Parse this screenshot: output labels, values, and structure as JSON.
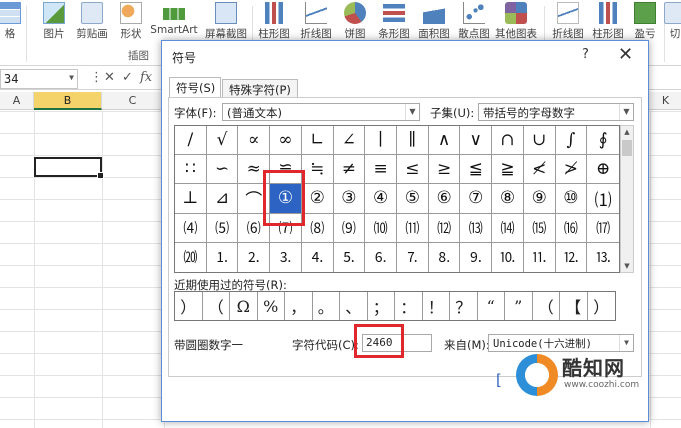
{
  "ribbon": {
    "buttons": [
      "格",
      "图片",
      "剪贴画",
      "形状",
      "SmartArt",
      "屏幕截图",
      "柱形图",
      "折线图",
      "饼图",
      "条形图",
      "面积图",
      "散点图",
      "其他图表",
      "折线图",
      "柱形图",
      "盈亏"
    ],
    "right_cut": "切",
    "group_label": "插图"
  },
  "formula_bar": {
    "name_box": "34",
    "cancel": "✕",
    "enter": "✓",
    "fx": "fx"
  },
  "columns": [
    "A",
    "B",
    "C",
    "K"
  ],
  "dialog": {
    "title": "符号",
    "help": "?",
    "close": "✕",
    "tabs": [
      "符号(S)",
      "特殊字符(P)"
    ],
    "font_label": "字体(F):",
    "font_value": "(普通文本)",
    "subset_label": "子集(U):",
    "subset_value": "带括号的字母数字",
    "symbols": [
      [
        "/",
        "√",
        "∝",
        "∞",
        "∟",
        "∠",
        "∣",
        "∥",
        "∧",
        "∨",
        "∩",
        "∪",
        "∫",
        "∮",
        "∴"
      ],
      [
        "∷",
        "∽",
        "≈",
        "≌",
        "≒",
        "≠",
        "≡",
        "≤",
        "≥",
        "≦",
        "≧",
        "≮",
        "≯",
        "⊕",
        "⊙"
      ],
      [
        "⊥",
        "⊿",
        "⌒",
        "①",
        "②",
        "③",
        "④",
        "⑤",
        "⑥",
        "⑦",
        "⑧",
        "⑨",
        "⑩",
        "⑴",
        "⑵"
      ],
      [
        "⑷",
        "⑸",
        "⑹",
        "⑺",
        "⑻",
        "⑼",
        "⑽",
        "⑾",
        "⑿",
        "⒀",
        "⒁",
        "⒂",
        "⒃",
        "⒄",
        "⒅"
      ],
      [
        "⒇",
        "⒈",
        "⒉",
        "⒊",
        "⒋",
        "⒌",
        "⒍",
        "⒎",
        "⒏",
        "⒐",
        "⒑",
        "⒒",
        "⒓",
        "⒔",
        "⒕"
      ]
    ],
    "recent_label": "近期使用过的符号(R):",
    "recent": [
      "）",
      "（",
      "Ω",
      "%",
      "，",
      "。",
      "、",
      "；",
      "：",
      "！",
      "？",
      "“",
      "”",
      "（",
      "【",
      "）"
    ],
    "char_name": "带圆圈数字一",
    "code_label": "字符代码(C):",
    "code_value": "2460",
    "from_label": "来自(M):",
    "from_value": "Unicode(十六进制)"
  },
  "watermark": {
    "name": "酷知网",
    "url": "www.coozhi.com"
  }
}
